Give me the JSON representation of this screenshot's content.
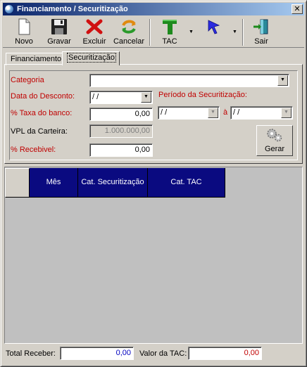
{
  "window": {
    "title": "Financiamento / Securitização",
    "close_glyph": "✕"
  },
  "toolbar": {
    "buttons": [
      {
        "label": "Novo",
        "icon": "new-document-icon"
      },
      {
        "label": "Gravar",
        "icon": "floppy-disk-icon"
      },
      {
        "label": "Excluir",
        "icon": "red-x-icon"
      },
      {
        "label": "Cancelar",
        "icon": "undo-arrows-icon"
      },
      {
        "label": "TAC",
        "icon": "green-t-icon"
      },
      {
        "label": "",
        "icon": "blue-arrow-cursor-icon"
      },
      {
        "label": "Sair",
        "icon": "exit-door-icon"
      }
    ]
  },
  "tabs": [
    {
      "label": "Financiamento",
      "active": false
    },
    {
      "label": "Securitização",
      "active": true
    }
  ],
  "form": {
    "categoria_label": "Categoria",
    "categoria_value": "",
    "data_desconto_label": "Data do Desconto:",
    "data_desconto_value": "/ /",
    "taxa_banco_label": "% Taxa do banco:",
    "taxa_banco_value": "0,00",
    "vpl_label": "VPL da Carteira:",
    "vpl_value": "1.000.000,00",
    "recebivel_label": "% Recebivel:",
    "recebivel_value": "0,00",
    "periodo_label": "Período da Securitização:",
    "periodo_de": "/ /",
    "periodo_sep": "à",
    "periodo_ate": "/ /",
    "gerar_label": "Gerar"
  },
  "grid": {
    "columns": [
      "Mês",
      "Cat. Securitização",
      "Cat. TAC"
    ]
  },
  "footer": {
    "total_receber_label": "Total Receber:",
    "total_receber_value": "0,00",
    "valor_tac_label": "Valor da TAC:",
    "valor_tac_value": "0,00"
  },
  "colors": {
    "title_gradient_start": "#0a246a",
    "required_label": "#c00000",
    "grid_header": "#0a0a80"
  }
}
